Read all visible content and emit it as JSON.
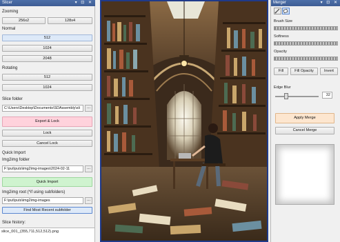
{
  "slicer": {
    "title": "Slicer",
    "controls": "▾ ⊡ ✕",
    "zooming_label": "Zooming",
    "zoom_buttons": [
      "256x2",
      "128x4"
    ],
    "normal_label": "Normal",
    "normal_buttons": [
      "512",
      "1024",
      "2048"
    ],
    "rotating_label": "Rotating",
    "rotating_buttons": [
      "512",
      "1024"
    ],
    "slice_folder_label": "Slice folder",
    "slice_folder_value": "C:\\Users\\Desktop\\Documents\\SDAssembly\\sli",
    "export_lock": "Export & Lock",
    "lock": "Lock",
    "cancel_lock": "Cancel Lock",
    "quick_import_label": "Quick Import",
    "img2img_folder_label": "Img2img folder",
    "img2img_folder_value": "F:\\put\\puts\\img2img-images\\2024-02-11",
    "quick_import_button": "Quick Import",
    "img2img_root_label": "Img2img root (*if using subfolders)",
    "img2img_root_value": "F:\\put\\puts\\img2img-images",
    "find_recent": "Find Most Recent subfolder",
    "slice_history_label": "Slice history:",
    "slice_history_item": "slice_001_(355,711,512,512).png",
    "dots": "..."
  },
  "merger": {
    "title": "Merger",
    "controls": "▾ ⊡ ✕",
    "brush_size_label": "Brush Size",
    "softness_label": "Softness",
    "opacity_label": "Opacity",
    "fill": "Fill",
    "fill_opacity": "Fill Opacity",
    "invert": "Invert",
    "edge_blur_label": "Edge Blur",
    "edge_blur_value": "32",
    "edge_blur_level": 0.25,
    "apply_merge": "Apply Merge",
    "cancel_merge": "Cancel Merge"
  },
  "colors": {
    "accent_blue": "#dde9f8",
    "export_pink": "#ffd2dc",
    "import_green": "#cff3cf",
    "apply_peach": "#fde6cf",
    "canvas_frame": "#1f3a8a"
  },
  "icons": {
    "brush_tool": "paintbrush-icon",
    "eraser_tool": "eraser-icon"
  }
}
